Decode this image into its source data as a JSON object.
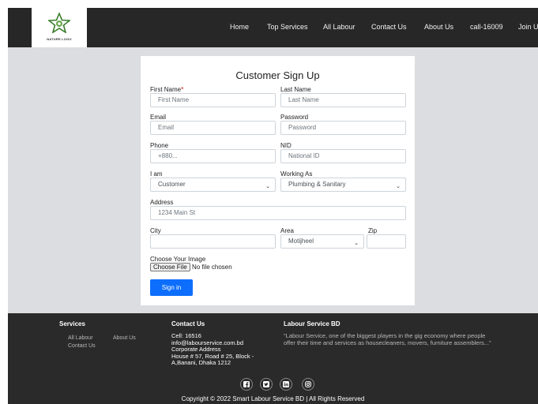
{
  "header": {
    "logo_text": "NATURE LOGO",
    "nav": [
      "Home",
      "Top Services",
      "All Labour",
      "Contact Us",
      "About Us",
      "call-16009",
      "Join Us"
    ]
  },
  "form": {
    "title": "Customer Sign Up",
    "first_name": {
      "label": "First Name",
      "required_mark": "*",
      "placeholder": "First Name"
    },
    "last_name": {
      "label": "Last Name",
      "placeholder": "Last Name"
    },
    "email": {
      "label": "Email",
      "placeholder": "Email"
    },
    "password": {
      "label": "Password",
      "placeholder": "Password"
    },
    "phone": {
      "label": "Phone",
      "placeholder": "+880..."
    },
    "nid": {
      "label": "NID",
      "placeholder": "National ID"
    },
    "role": {
      "label": "I am",
      "value": "Customer"
    },
    "working_as": {
      "label": "Working As",
      "value": "Plumbing & Sanitary"
    },
    "address": {
      "label": "Address",
      "placeholder": "1234 Main St"
    },
    "city": {
      "label": "City",
      "value": ""
    },
    "area": {
      "label": "Area",
      "value": "Motijheel"
    },
    "zip": {
      "label": "Zip",
      "value": ""
    },
    "image": {
      "label": "Choose Your Image",
      "button": "Choose File",
      "status": "No file chosen"
    },
    "submit": "Sign in"
  },
  "footer": {
    "services": {
      "heading": "Services",
      "links": [
        "All Labour",
        "About Us",
        "Contact Us"
      ]
    },
    "contact": {
      "heading": "Contact Us",
      "lines": [
        "Cell: 16516",
        "info@labourservice.com.bd",
        "Corporate Address",
        "House # 57, Road # 25, Block -",
        "A,Banani, Dhaka 1212"
      ]
    },
    "about": {
      "heading": "Labour Service BD",
      "quote": "\"Labour Service, one of the biggest players in the gig economy where people offer their time and services as housecleaners, movers, furniture assemblers...\""
    },
    "social_icons": [
      "facebook-icon",
      "twitter-icon",
      "linkedin-icon",
      "instagram-icon"
    ],
    "copyright": "Copyright © 2022 Smart Labour Service BD | All Rights Reserved"
  }
}
